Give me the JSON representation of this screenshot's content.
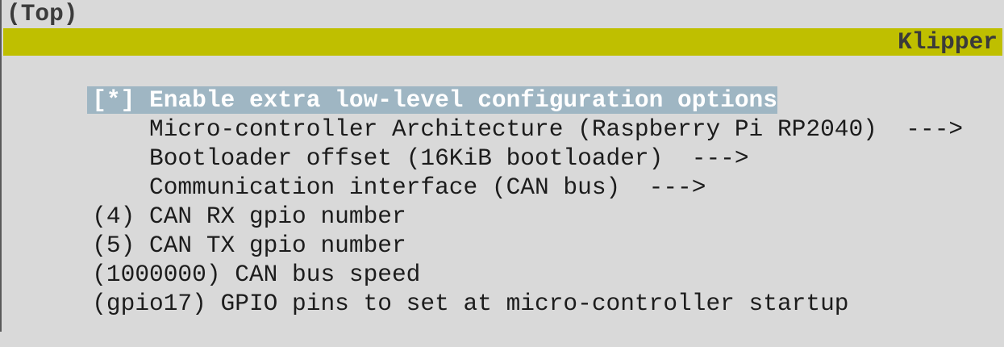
{
  "breadcrumb": "(Top)",
  "header": {
    "title": "Klipper"
  },
  "colors": {
    "background": "#d9d9d9",
    "title_bar": "#bfbf00",
    "selection": "#9fb6c3"
  },
  "menu": {
    "items": [
      {
        "prefix": "[*] ",
        "label": "Enable extra low-level configuration options",
        "value": "",
        "arrow": ""
      },
      {
        "prefix": "    ",
        "label": "Micro-controller Architecture ",
        "value": "(Raspberry Pi RP2040)",
        "arrow": "  --->"
      },
      {
        "prefix": "    ",
        "label": "Bootloader offset ",
        "value": "(16KiB bootloader)",
        "arrow": "  --->"
      },
      {
        "prefix": "    ",
        "label": "Communication interface ",
        "value": "(CAN bus)",
        "arrow": "  --->"
      },
      {
        "prefix": "(4) ",
        "label": "CAN RX gpio number",
        "value": "",
        "arrow": ""
      },
      {
        "prefix": "(5) ",
        "label": "CAN TX gpio number",
        "value": "",
        "arrow": ""
      },
      {
        "prefix": "(1000000) ",
        "label": "CAN bus speed",
        "value": "",
        "arrow": ""
      },
      {
        "prefix": "(gpio17) ",
        "label": "GPIO pins to set at micro-controller startup",
        "value": "",
        "arrow": ""
      }
    ]
  }
}
